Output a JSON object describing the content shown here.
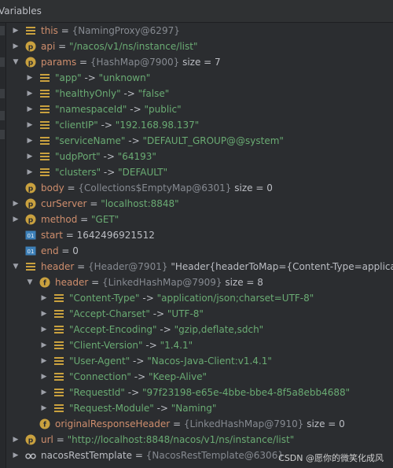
{
  "panel": {
    "title": "Variables"
  },
  "watermark": "CSDN @愿你的微笑化成风",
  "tree": [
    {
      "level": 0,
      "toggle": "collapsed",
      "icon": "field",
      "name": "this",
      "ref": "{NamingProxy@6297}"
    },
    {
      "level": 0,
      "toggle": "collapsed",
      "icon": "param",
      "name": "api",
      "str": "\"/nacos/v1/ns/instance/list\""
    },
    {
      "level": 0,
      "toggle": "expanded",
      "icon": "param",
      "name": "params",
      "ref": "{HashMap@7900}",
      "size": "size = 7"
    },
    {
      "level": 1,
      "toggle": "collapsed",
      "icon": "field",
      "key": "\"app\"",
      "val": "\"unknown\""
    },
    {
      "level": 1,
      "toggle": "collapsed",
      "icon": "field",
      "key": "\"healthyOnly\"",
      "val": "\"false\""
    },
    {
      "level": 1,
      "toggle": "collapsed",
      "icon": "field",
      "key": "\"namespaceId\"",
      "val": "\"public\""
    },
    {
      "level": 1,
      "toggle": "collapsed",
      "icon": "field",
      "key": "\"clientIP\"",
      "val": "\"192.168.98.137\""
    },
    {
      "level": 1,
      "toggle": "collapsed",
      "icon": "field",
      "key": "\"serviceName\"",
      "val": "\"DEFAULT_GROUP@@system\""
    },
    {
      "level": 1,
      "toggle": "collapsed",
      "icon": "field",
      "key": "\"udpPort\"",
      "val": "\"64193\""
    },
    {
      "level": 1,
      "toggle": "collapsed",
      "icon": "field",
      "key": "\"clusters\"",
      "val": "\"DEFAULT\""
    },
    {
      "level": 0,
      "toggle": "none",
      "icon": "param",
      "name": "body",
      "ref": "{Collections$EmptyMap@6301}",
      "size": "size = 0"
    },
    {
      "level": 0,
      "toggle": "collapsed",
      "icon": "param",
      "name": "curServer",
      "str": "\"localhost:8848\""
    },
    {
      "level": 0,
      "toggle": "collapsed",
      "icon": "param",
      "name": "method",
      "str": "\"GET\""
    },
    {
      "level": 0,
      "toggle": "none",
      "icon": "prim",
      "name": "start",
      "num": "1642496921512"
    },
    {
      "level": 0,
      "toggle": "none",
      "icon": "prim",
      "name": "end",
      "num": "0"
    },
    {
      "level": 0,
      "toggle": "expanded",
      "icon": "field",
      "name": "header",
      "ref": "{Header@7901}",
      "extra": "\"Header{headerToMap={Content-Type=application"
    },
    {
      "level": 1,
      "toggle": "expanded",
      "icon": "final",
      "name": "header",
      "ref": "{LinkedHashMap@7909}",
      "size": "size = 8"
    },
    {
      "level": 2,
      "toggle": "collapsed",
      "icon": "field",
      "key": "\"Content-Type\"",
      "val": "\"application/json;charset=UTF-8\""
    },
    {
      "level": 2,
      "toggle": "collapsed",
      "icon": "field",
      "key": "\"Accept-Charset\"",
      "val": "\"UTF-8\""
    },
    {
      "level": 2,
      "toggle": "collapsed",
      "icon": "field",
      "key": "\"Accept-Encoding\"",
      "val": "\"gzip,deflate,sdch\""
    },
    {
      "level": 2,
      "toggle": "collapsed",
      "icon": "field",
      "key": "\"Client-Version\"",
      "val": "\"1.4.1\""
    },
    {
      "level": 2,
      "toggle": "collapsed",
      "icon": "field",
      "key": "\"User-Agent\"",
      "val": "\"Nacos-Java-Client:v1.4.1\""
    },
    {
      "level": 2,
      "toggle": "collapsed",
      "icon": "field",
      "key": "\"Connection\"",
      "val": "\"Keep-Alive\""
    },
    {
      "level": 2,
      "toggle": "collapsed",
      "icon": "field",
      "key": "\"RequestId\"",
      "val": "\"97f23198-e65e-4bbe-bbe4-8f5a8ebb4688\""
    },
    {
      "level": 2,
      "toggle": "collapsed",
      "icon": "field",
      "key": "\"Request-Module\"",
      "val": "\"Naming\""
    },
    {
      "level": 1,
      "toggle": "none",
      "icon": "final",
      "name": "originalResponseHeader",
      "ref": "{LinkedHashMap@7910}",
      "size": "size = 0"
    },
    {
      "level": 0,
      "toggle": "collapsed",
      "icon": "param",
      "name": "url",
      "str": "\"http://localhost:8848/nacos/v1/ns/instance/list\""
    },
    {
      "level": 0,
      "toggle": "collapsed",
      "icon": "watch",
      "name": "nacosRestTemplate",
      "ref": "{NacosRestTemplate@6306}"
    }
  ]
}
